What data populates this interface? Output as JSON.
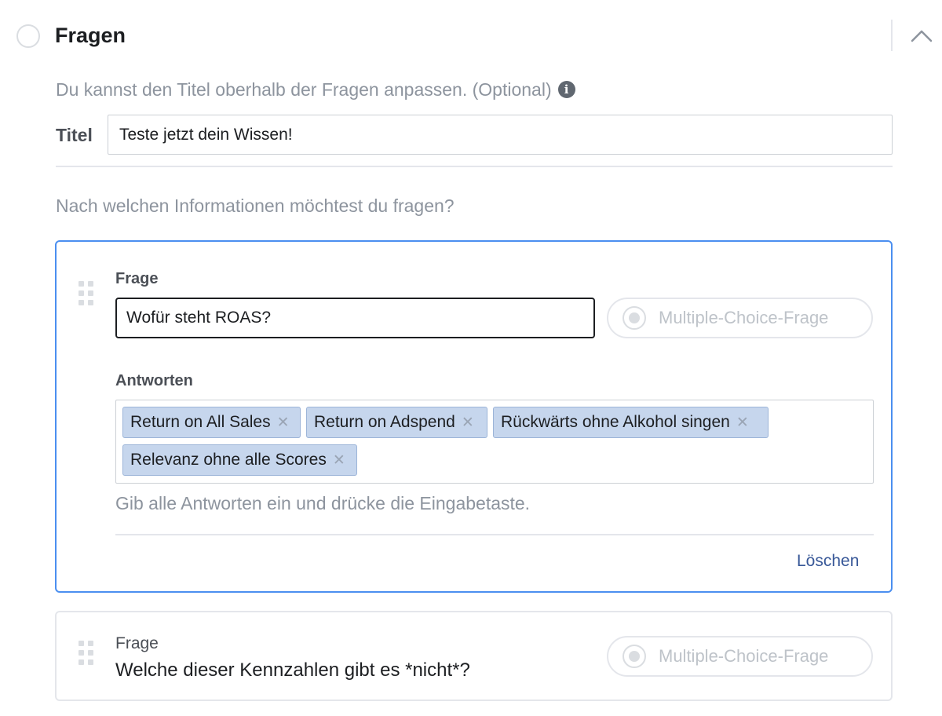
{
  "section": {
    "title": "Fragen",
    "help_text": "Du kannst den Titel oberhalb der Fragen anpassen. (Optional)",
    "info_icon_glyph": "i",
    "titel_label": "Titel",
    "titel_value": "Teste jetzt dein Wissen!",
    "ask_text": "Nach welchen Informationen möchtest du fragen?"
  },
  "questions": [
    {
      "frage_label": "Frage",
      "frage_value": "Wofür steht ROAS?",
      "type_label": "Multiple-Choice-Frage",
      "antworten_label": "Antworten",
      "answers": [
        "Return on All Sales",
        "Return on Adspend",
        "Rückwärts ohne Alkohol singen",
        "Relevanz ohne alle Scores"
      ],
      "hint": "Gib alle Antworten ein und drücke die Eingabetaste.",
      "delete_label": "Löschen"
    },
    {
      "frage_label": "Frage",
      "frage_value": "Welche dieser Kennzahlen gibt es *nicht*?",
      "type_label": "Multiple-Choice-Frage"
    }
  ],
  "icons": {
    "remove_glyph": "✕"
  },
  "colors": {
    "accent_border": "#4b8ff0",
    "token_bg": "#c6d6ed",
    "link": "#385898"
  }
}
